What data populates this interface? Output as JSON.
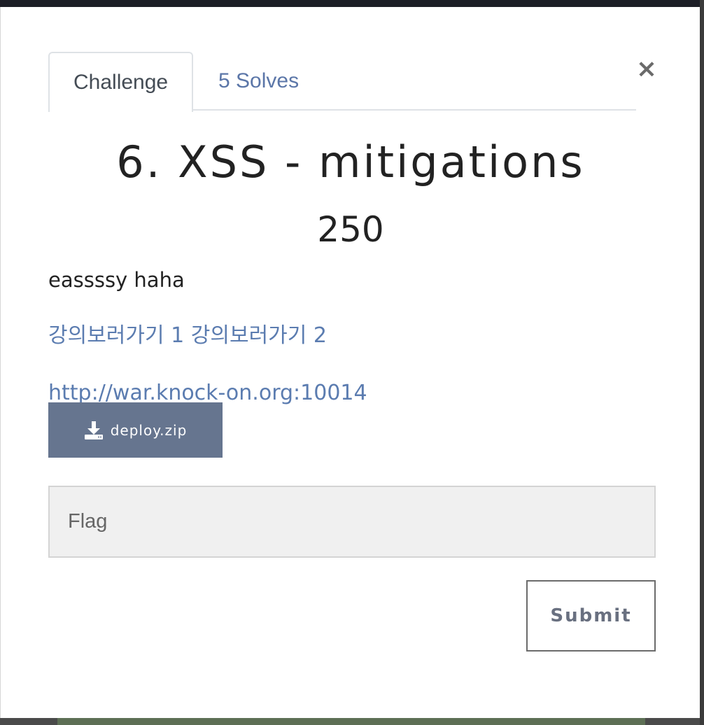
{
  "modal": {
    "tabs": [
      {
        "label": "Challenge",
        "active": true
      },
      {
        "label": "5 Solves",
        "active": false
      }
    ],
    "close_glyph": "×",
    "title": "6. XSS - mitigations",
    "points": "250",
    "description": "eassssy haha",
    "links": [
      {
        "label": "강의보러가기 1"
      },
      {
        "label": "강의보러가기 2"
      }
    ],
    "url": "http://war.knock-on.org:10014",
    "download": {
      "label": "deploy.zip",
      "icon": "download-icon"
    },
    "flag_input": {
      "placeholder": "Flag",
      "value": ""
    },
    "submit_label": "Submit"
  },
  "colors": {
    "link": "#5b7cb0",
    "download_button": "#66758f",
    "input_bg": "#f0f0f0"
  }
}
